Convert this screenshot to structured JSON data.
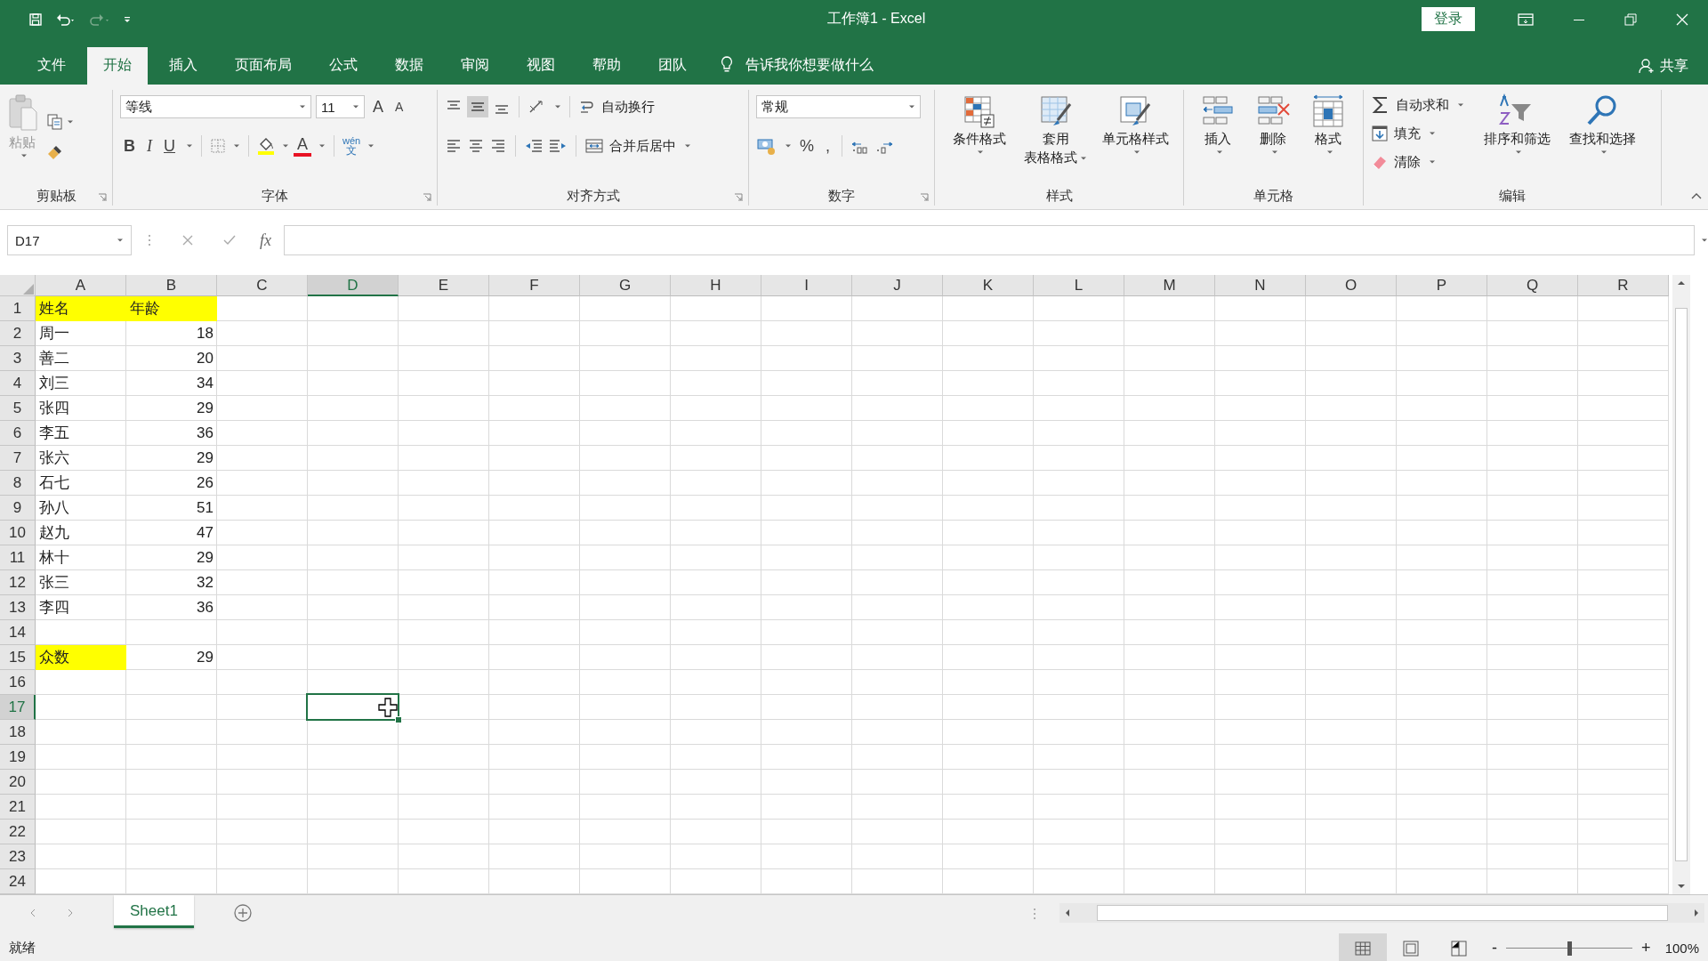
{
  "title_bar": {
    "title": "工作簿1 - Excel",
    "sign_in": "登录"
  },
  "menu_tabs": [
    {
      "label": "文件",
      "selected": false
    },
    {
      "label": "开始",
      "selected": true
    },
    {
      "label": "插入",
      "selected": false
    },
    {
      "label": "页面布局",
      "selected": false
    },
    {
      "label": "公式",
      "selected": false
    },
    {
      "label": "数据",
      "selected": false
    },
    {
      "label": "审阅",
      "selected": false
    },
    {
      "label": "视图",
      "selected": false
    },
    {
      "label": "帮助",
      "selected": false
    },
    {
      "label": "团队",
      "selected": false
    }
  ],
  "tell_me": "告诉我你想要做什么",
  "share": "共享",
  "ribbon": {
    "clipboard": {
      "paste": "粘贴",
      "label": "剪贴板"
    },
    "font": {
      "font_name": "等线",
      "font_size": "11",
      "grow": "A",
      "shrink": "A",
      "bold": "B",
      "italic": "I",
      "underline": "U",
      "font_color": "A",
      "phonetic_top": "wén",
      "phonetic_bottom": "文",
      "label": "字体"
    },
    "alignment": {
      "wrap_text": "自动换行",
      "merge_center": "合并后居中",
      "label": "对齐方式"
    },
    "number": {
      "format": "常规",
      "percent": "%",
      "comma": ",",
      "label": "数字"
    },
    "styles": {
      "conditional": "条件格式",
      "table_line1": "套用",
      "table_line2": "表格格式",
      "cell_styles": "单元格样式",
      "label": "样式"
    },
    "cells": {
      "insert": "插入",
      "delete": "删除",
      "format": "格式",
      "label": "单元格"
    },
    "editing": {
      "autosum": "自动求和",
      "fill": "填充",
      "clear": "清除",
      "sort_filter": "排序和筛选",
      "find_select": "查找和选择",
      "label": "编辑"
    }
  },
  "name_box": "D17",
  "function_label": "fx",
  "columns": [
    {
      "label": "A",
      "selected": false
    },
    {
      "label": "B",
      "selected": false
    },
    {
      "label": "C",
      "selected": false
    },
    {
      "label": "D",
      "selected": true
    },
    {
      "label": "E",
      "selected": false
    },
    {
      "label": "F",
      "selected": false
    },
    {
      "label": "G",
      "selected": false
    },
    {
      "label": "H",
      "selected": false
    },
    {
      "label": "I",
      "selected": false
    },
    {
      "label": "J",
      "selected": false
    },
    {
      "label": "K",
      "selected": false
    },
    {
      "label": "L",
      "selected": false
    },
    {
      "label": "M",
      "selected": false
    },
    {
      "label": "N",
      "selected": false
    },
    {
      "label": "O",
      "selected": false
    },
    {
      "label": "P",
      "selected": false
    },
    {
      "label": "Q",
      "selected": false
    },
    {
      "label": "R",
      "selected": false
    }
  ],
  "rows": [
    {
      "label": "1",
      "selected": false,
      "cells": [
        {
          "text": "姓名",
          "kind": "text",
          "highlighted": true
        },
        {
          "text": "年龄",
          "kind": "text",
          "highlighted": true
        }
      ]
    },
    {
      "label": "2",
      "selected": false,
      "cells": [
        {
          "text": "周一",
          "kind": "text",
          "highlighted": false
        },
        {
          "text": "18",
          "kind": "number",
          "highlighted": false
        }
      ]
    },
    {
      "label": "3",
      "selected": false,
      "cells": [
        {
          "text": "善二",
          "kind": "text",
          "highlighted": false
        },
        {
          "text": "20",
          "kind": "number",
          "highlighted": false
        }
      ]
    },
    {
      "label": "4",
      "selected": false,
      "cells": [
        {
          "text": "刘三",
          "kind": "text",
          "highlighted": false
        },
        {
          "text": "34",
          "kind": "number",
          "highlighted": false
        }
      ]
    },
    {
      "label": "5",
      "selected": false,
      "cells": [
        {
          "text": "张四",
          "kind": "text",
          "highlighted": false
        },
        {
          "text": "29",
          "kind": "number",
          "highlighted": false
        }
      ]
    },
    {
      "label": "6",
      "selected": false,
      "cells": [
        {
          "text": "李五",
          "kind": "text",
          "highlighted": false
        },
        {
          "text": "36",
          "kind": "number",
          "highlighted": false
        }
      ]
    },
    {
      "label": "7",
      "selected": false,
      "cells": [
        {
          "text": "张六",
          "kind": "text",
          "highlighted": false
        },
        {
          "text": "29",
          "kind": "number",
          "highlighted": false
        }
      ]
    },
    {
      "label": "8",
      "selected": false,
      "cells": [
        {
          "text": "石七",
          "kind": "text",
          "highlighted": false
        },
        {
          "text": "26",
          "kind": "number",
          "highlighted": false
        }
      ]
    },
    {
      "label": "9",
      "selected": false,
      "cells": [
        {
          "text": "孙八",
          "kind": "text",
          "highlighted": false
        },
        {
          "text": "51",
          "kind": "number",
          "highlighted": false
        }
      ]
    },
    {
      "label": "10",
      "selected": false,
      "cells": [
        {
          "text": "赵九",
          "kind": "text",
          "highlighted": false
        },
        {
          "text": "47",
          "kind": "number",
          "highlighted": false
        }
      ]
    },
    {
      "label": "11",
      "selected": false,
      "cells": [
        {
          "text": "林十",
          "kind": "text",
          "highlighted": false
        },
        {
          "text": "29",
          "kind": "number",
          "highlighted": false
        }
      ]
    },
    {
      "label": "12",
      "selected": false,
      "cells": [
        {
          "text": "张三",
          "kind": "text",
          "highlighted": false
        },
        {
          "text": "32",
          "kind": "number",
          "highlighted": false
        }
      ]
    },
    {
      "label": "13",
      "selected": false,
      "cells": [
        {
          "text": "李四",
          "kind": "text",
          "highlighted": false
        },
        {
          "text": "36",
          "kind": "number",
          "highlighted": false
        }
      ]
    },
    {
      "label": "14",
      "selected": false,
      "cells": []
    },
    {
      "label": "15",
      "selected": false,
      "cells": [
        {
          "text": "众数",
          "kind": "text",
          "highlighted": true
        },
        {
          "text": "29",
          "kind": "number",
          "highlighted": false
        }
      ]
    },
    {
      "label": "16",
      "selected": false,
      "cells": []
    },
    {
      "label": "17",
      "selected": true,
      "cells": []
    },
    {
      "label": "18",
      "selected": false,
      "cells": []
    },
    {
      "label": "19",
      "selected": false,
      "cells": []
    },
    {
      "label": "20",
      "selected": false,
      "cells": []
    },
    {
      "label": "21",
      "selected": false,
      "cells": []
    },
    {
      "label": "22",
      "selected": false,
      "cells": []
    },
    {
      "label": "23",
      "selected": false,
      "cells": []
    },
    {
      "label": "24",
      "selected": false,
      "cells": []
    }
  ],
  "sheet_tabs": [
    {
      "label": "Sheet1",
      "selected": true
    }
  ],
  "status_bar": {
    "text": "就绪",
    "views": [
      {
        "kind": "normal",
        "selected": true
      },
      {
        "kind": "page_layout",
        "selected": false
      },
      {
        "kind": "page_break",
        "selected": false
      }
    ],
    "zoom_out": "-",
    "zoom_in": "+",
    "zoom": {
      "level": 0.5
    },
    "zoom_text": "100%"
  }
}
